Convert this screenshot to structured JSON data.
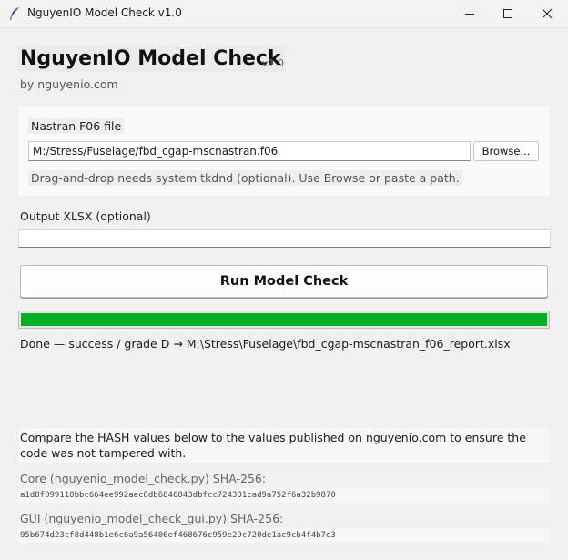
{
  "window": {
    "title": "NguyenIO Model Check v1.0",
    "minimize_icon": "minimize-icon",
    "maximize_icon": "maximize-icon",
    "close_icon": "close-icon"
  },
  "header": {
    "title": "NguyenIO Model Check",
    "version": "v1.0",
    "byline": "by nguyenio.com"
  },
  "f06": {
    "label": "Nastran F06 file",
    "value": "M:/Stress/Fuselage/fbd_cgap-mscnastran.f06",
    "browse_label": "Browse...",
    "hint": "Drag-and-drop needs system tkdnd (optional). Use Browse or paste a path."
  },
  "output": {
    "label": "Output XLSX (optional)",
    "value": ""
  },
  "run": {
    "label": "Run Model Check"
  },
  "progress": {
    "fraction": 1.0,
    "color": "#06b025"
  },
  "status": "Done — success / grade D → M:\\Stress\\Fuselage\\fbd_cgap-mscnastran_f06_report.xlsx",
  "hashes": {
    "note": "Compare the HASH values below to the values published on nguyenio.com to ensure the code was not tampered with.",
    "core_label": "Core (nguyenio_model_check.py) SHA-256:",
    "core_value": "a1d8f099110bbc664ee992aec8db6846843dbfcc724301cad9a752f6a32b9870",
    "gui_label": "GUI (nguyenio_model_check_gui.py) SHA-256:",
    "gui_value": "95b674d23cf8d448b1e6c6a9a56406ef468676c959e29c720de1ac9cb4f4b7e3"
  }
}
